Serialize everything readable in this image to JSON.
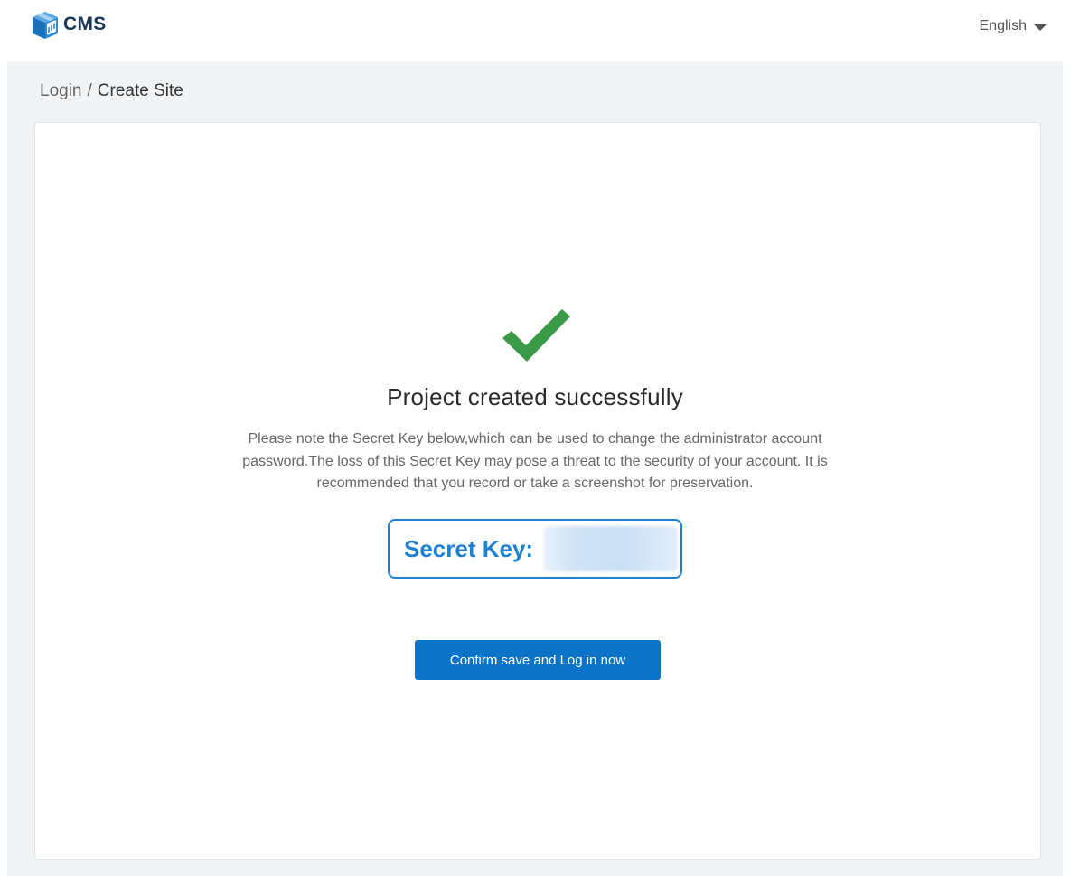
{
  "header": {
    "logo_text": "CMS",
    "logo_icon": "cube-box-icon",
    "language": {
      "selected": "English",
      "icon": "caret-down-icon"
    }
  },
  "breadcrumb": {
    "items": [
      {
        "label": "Login"
      },
      {
        "label": "Create Site"
      }
    ],
    "separator": "/"
  },
  "result": {
    "icon": "checkmark-icon",
    "icon_color": "#3a9a47",
    "title": "Project created successfully",
    "message_lines": [
      "Please note the Secret Key below,which can be used to change the administrator account",
      "password.The loss of this Secret Key may pose a threat to the security of your account. It is",
      "recommended that you record or take a screenshot for preservation."
    ],
    "secret_key": {
      "label": "Secret Key:",
      "value": "",
      "accent_color": "#1f7fd1"
    },
    "confirm_button_label": "Confirm save and Log in now",
    "button_color": "#0b74c9"
  }
}
